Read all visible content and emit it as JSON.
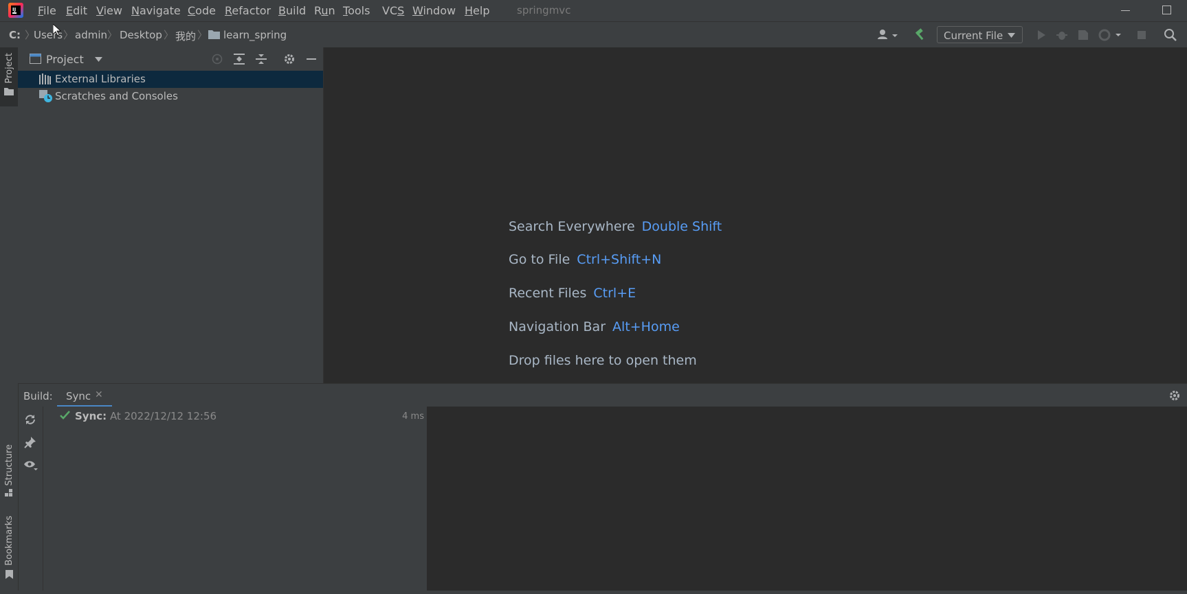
{
  "window": {
    "title": "springmvc"
  },
  "menu": {
    "items": [
      {
        "pre": "",
        "mn": "F",
        "post": "ile"
      },
      {
        "pre": "",
        "mn": "E",
        "post": "dit"
      },
      {
        "pre": "",
        "mn": "V",
        "post": "iew"
      },
      {
        "pre": "",
        "mn": "N",
        "post": "avigate"
      },
      {
        "pre": "",
        "mn": "C",
        "post": "ode"
      },
      {
        "pre": "",
        "mn": "R",
        "post": "efactor"
      },
      {
        "pre": "",
        "mn": "B",
        "post": "uild"
      },
      {
        "pre": "R",
        "mn": "u",
        "post": "n"
      },
      {
        "pre": "",
        "mn": "T",
        "post": "ools"
      },
      {
        "pre": "VC",
        "mn": "S",
        "post": ""
      },
      {
        "pre": "",
        "mn": "W",
        "post": "indow"
      },
      {
        "pre": "",
        "mn": "H",
        "post": "elp"
      }
    ]
  },
  "breadcrumb": [
    "C:",
    "Users",
    "admin",
    "Desktop",
    "我的",
    "learn_spring"
  ],
  "toolbar": {
    "run_config": "Current File"
  },
  "left_stripe": {
    "project": "Project",
    "structure": "Structure",
    "bookmarks": "Bookmarks"
  },
  "project_panel": {
    "title": "Project",
    "tree": [
      {
        "label": "External Libraries",
        "icon": "library-icon",
        "selected": true
      },
      {
        "label": "Scratches and Consoles",
        "icon": "scratches-icon",
        "selected": false
      }
    ]
  },
  "editor": {
    "hints": [
      {
        "text": "Search Everywhere",
        "key": "Double Shift"
      },
      {
        "text": "Go to File",
        "key": "Ctrl+Shift+N"
      },
      {
        "text": "Recent Files",
        "key": "Ctrl+E"
      },
      {
        "text": "Navigation Bar",
        "key": "Alt+Home"
      },
      {
        "text": "Drop files here to open them",
        "key": ""
      }
    ]
  },
  "build": {
    "title": "Build:",
    "tab": "Sync",
    "sync_label": "Sync:",
    "sync_time": "At 2022/12/12 12:56",
    "duration": "4 ms"
  },
  "colors": {
    "accent": "#589df6",
    "selection": "#0d293e",
    "success": "#59a869"
  }
}
